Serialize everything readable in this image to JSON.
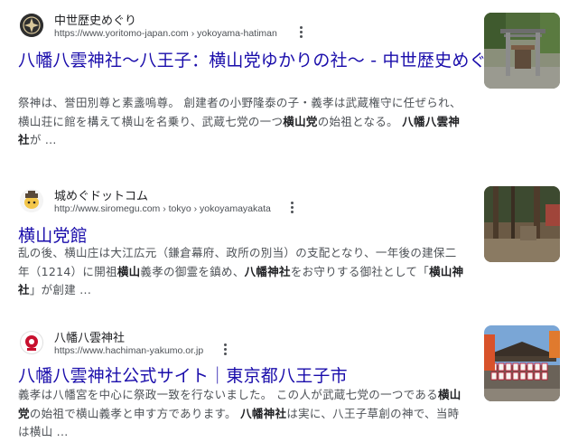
{
  "results": [
    {
      "site_name": "中世歴史めぐり",
      "site_url": "https://www.yoritomo-japan.com › yokoyama-hatiman",
      "title": "八幡八雲神社〜八王子：横山党ゆかりの社〜 - 中世歴史めぐり",
      "snippet": {
        "line1": "祭神は、誉田別尊と素盞嗚尊。 創建者の小野隆泰の子・義孝は武蔵権守に任ぜられ、",
        "line2_a": "横山荘に館を構えて横山を名乗り、武蔵七党の一つ",
        "line2_b": "横山党",
        "line2_c": "の始祖となる。 ",
        "line2_d": "八幡八雲神",
        "line3_a": "社",
        "line3_b": "が ..."
      },
      "favicon": "site-logo-icon",
      "thumbnail": "shrine-torii-photo"
    },
    {
      "site_name": "城めぐドットコム",
      "site_url": "http://www.siromegu.com › tokyo › yokoyamayakata",
      "title": "横山党館",
      "snippet": {
        "line1": "乱の後、横山庄は大江広元（鎌倉幕府、政所の別当）の支配となり、一年後の建保二",
        "line2_a": "年（1214）に開祖",
        "line2_b": "横山",
        "line2_c": "義孝の御霊を鎮め、",
        "line2_d": "八幡神社",
        "line2_e": "をお守りする御社として「",
        "line2_f": "横山神",
        "line3_a": "社",
        "line3_b": "」が創建 ..."
      },
      "favicon": "castle-mascot-icon",
      "thumbnail": "shrine-grounds-photo"
    },
    {
      "site_name": "八幡八雲神社",
      "site_url": "https://www.hachiman-yakumo.or.jp",
      "title": "八幡八雲神社公式サイト｜東京都八王子市",
      "snippet": {
        "line1_a": "義孝は八幡宮を中心に祭政一致を行ないました。 この人が武蔵七党の一つである",
        "line1_b": "横山",
        "line2_a": "党",
        "line2_b": "の始祖で横山義孝と申す方であります。 ",
        "line2_c": "八幡神社",
        "line2_d": "は実に、八王子草創の神で、当時",
        "line3": "は横山 ..."
      },
      "favicon": "shrine-crest-icon",
      "thumbnail": "lantern-hall-photo"
    }
  ],
  "colors": {
    "title_link": "#1a0dab",
    "snippet": "#4d5156",
    "site_name": "#202124"
  }
}
